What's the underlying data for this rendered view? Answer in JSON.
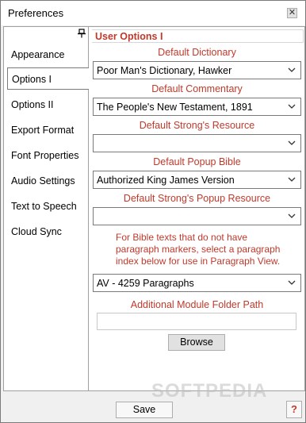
{
  "window": {
    "title": "Preferences"
  },
  "sidebar": {
    "items": [
      {
        "label": "Appearance"
      },
      {
        "label": "Options I"
      },
      {
        "label": "Options II"
      },
      {
        "label": "Export Format"
      },
      {
        "label": "Font Properties"
      },
      {
        "label": "Audio Settings"
      },
      {
        "label": "Text to Speech"
      },
      {
        "label": "Cloud Sync"
      }
    ],
    "selected": "Options I"
  },
  "panel": {
    "title": "User Options I",
    "fields": [
      {
        "label": "Default Dictionary",
        "value": "Poor Man's Dictionary, Hawker"
      },
      {
        "label": "Default Commentary",
        "value": "The People's New Testament, 1891"
      },
      {
        "label": "Default Strong's Resource",
        "value": ""
      },
      {
        "label": "Default Popup Bible",
        "value": "Authorized King James Version"
      },
      {
        "label": "Default Strong's Popup Resource",
        "value": ""
      }
    ],
    "paragraph_note": "For Bible texts that do not have paragraph markers, select a paragraph index below for use in Paragraph View.",
    "paragraph_index": {
      "value": "AV - 4259 Paragraphs"
    },
    "module_folder": {
      "label": "Additional Module Folder Path",
      "value": ""
    },
    "browse_label": "Browse"
  },
  "footer": {
    "save_label": "Save",
    "help_label": "?"
  },
  "watermark": "SOFTPEDIA",
  "colors": {
    "accent": "#c0392b",
    "border": "#7a7a7a"
  }
}
